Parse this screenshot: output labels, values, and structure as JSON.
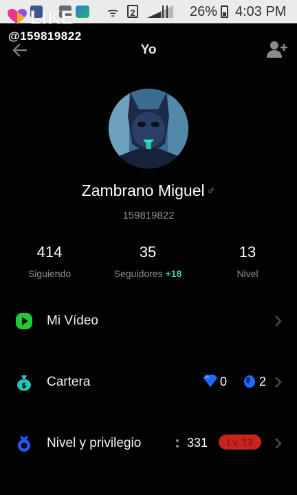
{
  "status_bar": {
    "battery": "26%",
    "time": "4:03 PM",
    "sim_label": "2"
  },
  "watermark": {
    "brand": "LIKE",
    "user_handle": "@159819822"
  },
  "header": {
    "title": "Yo",
    "back_icon": "arrow-left-icon",
    "add_icon": "add-user-icon"
  },
  "profile": {
    "name": "Zambrano Miguel",
    "gender_symbol": "♂",
    "id": "159819822"
  },
  "stats": [
    {
      "value": "414",
      "label": "Siguiendo"
    },
    {
      "value": "35",
      "label": "Seguidores",
      "delta": "+18"
    },
    {
      "value": "13",
      "label": "Nivel"
    }
  ],
  "menu": {
    "video": {
      "label": "Mi Vídeo",
      "icon": "play-icon"
    },
    "wallet": {
      "label": "Cartera",
      "icon": "wallet-bag-icon",
      "diamonds": "0",
      "beans": "2"
    },
    "level": {
      "label": "Nivel y privilegio",
      "icon": "level-ring-icon",
      "points": "331",
      "badge": "Lv. 13"
    }
  },
  "colors": {
    "background": "#020202",
    "accent_green": "#4ed0a6",
    "video_icon": "#1fc93a",
    "wallet_icon": "#27c3b6",
    "level_icon": "#1f5cff",
    "diamond": "#1f6bff",
    "level_badge": "#c8231c"
  }
}
